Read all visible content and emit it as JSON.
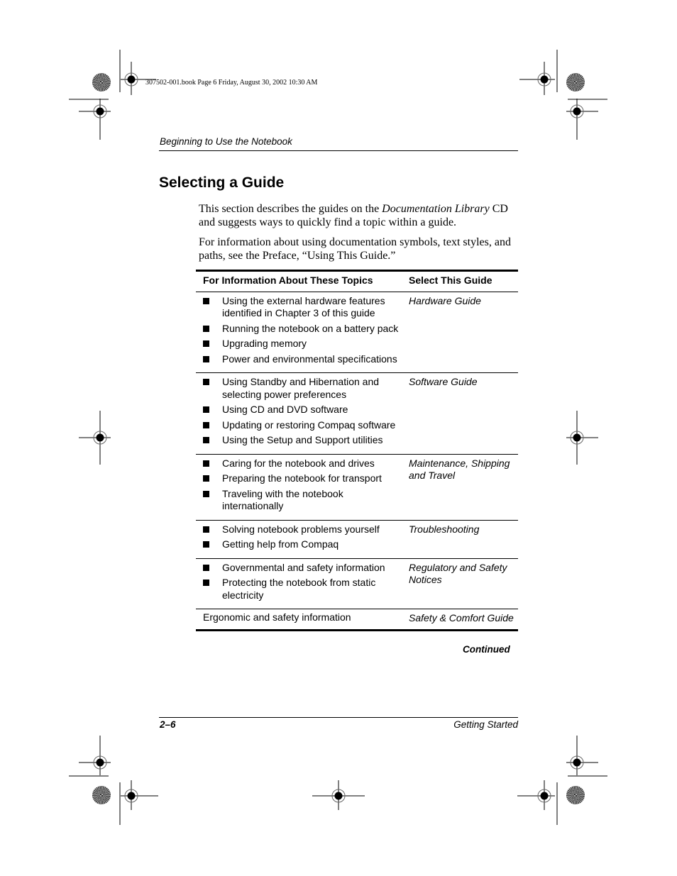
{
  "slug": "307502-001.book  Page 6  Friday, August 30, 2002  10:30 AM",
  "running_head": "Beginning to Use the Notebook",
  "section_title": "Selecting a Guide",
  "intro": {
    "p1_before": "This section describes the guides on the ",
    "p1_italic": "Documentation Library",
    "p1_after": " CD and suggests ways to quickly find a topic within a guide.",
    "p2": "For information about using documentation symbols, text styles, and paths, see the Preface, “Using This Guide.”"
  },
  "table": {
    "headers": [
      "For Information About These Topics",
      "Select This Guide"
    ],
    "rows": [
      {
        "topics": [
          "Using the external hardware features identified in Chapter 3 of this guide",
          "Running the notebook on a battery pack",
          "Upgrading memory",
          "Power and environmental specifications"
        ],
        "guide": "Hardware Guide"
      },
      {
        "topics": [
          "Using Standby and Hibernation and selecting power preferences",
          "Using CD and DVD software",
          "Updating or restoring Compaq software",
          "Using the Setup and Support utilities"
        ],
        "guide": "Software Guide"
      },
      {
        "topics": [
          "Caring for the notebook and drives",
          "Preparing the notebook for transport",
          "Traveling with the notebook internationally"
        ],
        "guide": "Maintenance, Shipping and Travel"
      },
      {
        "topics": [
          "Solving notebook problems yourself",
          "Getting help from Compaq"
        ],
        "guide": "Troubleshooting"
      },
      {
        "topics": [
          "Governmental and safety information",
          "Protecting the notebook from static electricity"
        ],
        "guide": "Regulatory and Safety Notices"
      },
      {
        "plain": "Ergonomic and safety information",
        "guide": "Safety & Comfort Guide"
      }
    ],
    "continued": "Continued"
  },
  "footer": {
    "page_number": "2–6",
    "book_title": "Getting Started"
  }
}
